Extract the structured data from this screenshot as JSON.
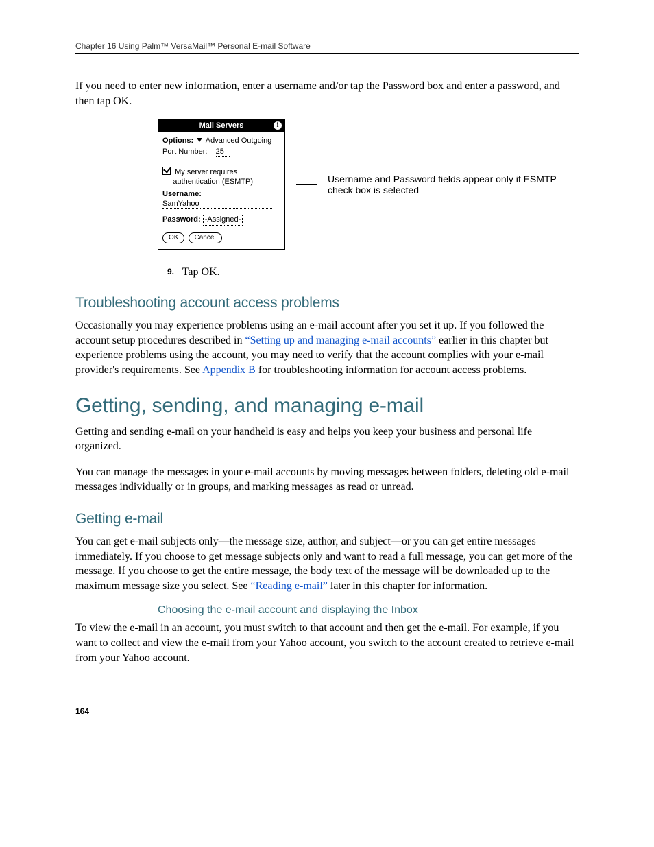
{
  "header": {
    "line": "Chapter 16   Using Palm™ VersaMail™ Personal E-mail Software"
  },
  "intro_para": "If you need to enter new information, enter a username and/or tap the Password box and enter a password, and then tap OK.",
  "device": {
    "title": "Mail Servers",
    "options_label": "Options:",
    "options_value": "Advanced Outgoing",
    "port_label": "Port Number:",
    "port_value": "25",
    "checkbox_label_line1": "My server requires",
    "checkbox_label_line2": "authentication (ESMTP)",
    "username_label": "Username:",
    "username_value": "SamYahoo",
    "password_label": "Password:",
    "password_value": "-Assigned-",
    "ok": "OK",
    "cancel": "Cancel"
  },
  "callout": "Username and Password fields appear only if ESMTP check box is selected",
  "step": {
    "num": "9.",
    "text": "Tap OK."
  },
  "h3_troubleshoot": "Troubleshooting account access problems",
  "troubleshoot_para": {
    "pre": "Occasionally you may experience problems using an e-mail account after you set it up. If you followed the account setup procedures described in ",
    "link1": "“Setting up and managing e-mail accounts”",
    "mid": " earlier in this chapter but experience problems using the account, you may need to verify that the account complies with your e-mail provider's requirements. See ",
    "link2": "Appendix B",
    "post": " for troubleshooting information for account access problems."
  },
  "h2_getting": "Getting, sending, and managing e-mail",
  "getting_p1": "Getting and sending e-mail on your handheld is easy and helps you keep your business and personal life organized.",
  "getting_p2": "You can manage the messages in your e-mail accounts by moving messages between folders, deleting old e-mail messages individually or in groups, and marking messages as read or unread.",
  "h3_getting_email": "Getting e-mail",
  "getting_email_para": {
    "pre": "You can get e-mail subjects only—the message size, author, and subject—or you can get entire messages immediately. If you choose to get message subjects only and want to read a full message, you can get more of the message. If you choose to get the entire message, the body text of the message will be downloaded up to the maximum message size you select. See ",
    "link": "“Reading e-mail”",
    "post": " later in this chapter for information."
  },
  "h4_choosing": "Choosing the e-mail account and displaying the Inbox",
  "choosing_para": "To view the e-mail in an account, you must switch to that account and then get the e-mail. For example, if you want to collect and view the e-mail from your Yahoo account, you switch to the account created to retrieve e-mail from your Yahoo account.",
  "page_number": "164"
}
